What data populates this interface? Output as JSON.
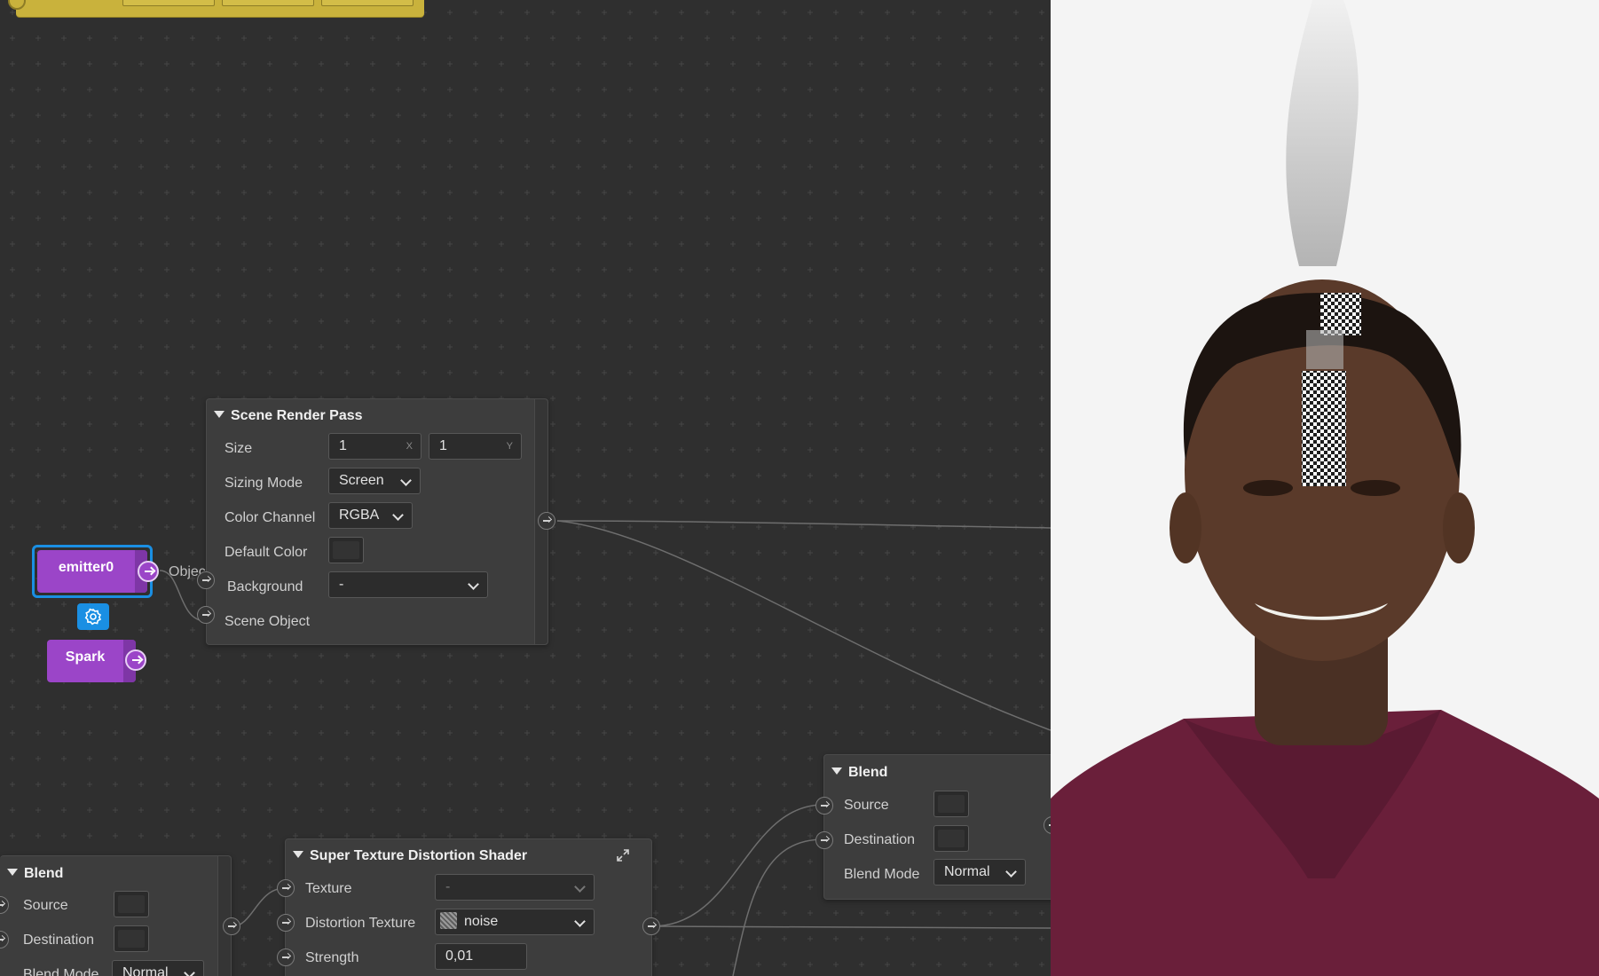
{
  "emitter": {
    "name": "emitter0",
    "out_label": "Object"
  },
  "spark": {
    "name": "Spark"
  },
  "scene_render_pass": {
    "title": "Scene Render Pass",
    "size_label": "Size",
    "size_x": "1",
    "size_x_suffix": "X",
    "size_y": "1",
    "size_y_suffix": "Y",
    "sizing_mode_label": "Sizing Mode",
    "sizing_mode": "Screen",
    "color_channel_label": "Color Channel",
    "color_channel": "RGBA",
    "default_color_label": "Default Color",
    "background_label": "Background",
    "background": "-",
    "scene_object_label": "Scene Object"
  },
  "blend_right": {
    "title": "Blend",
    "source_label": "Source",
    "destination_label": "Destination",
    "blend_mode_label": "Blend Mode",
    "blend_mode": "Normal"
  },
  "blend_left": {
    "title": "Blend",
    "source_label": "Source",
    "destination_label": "Destination",
    "blend_mode_label": "Blend Mode",
    "blend_mode": "Normal"
  },
  "distortion_shader": {
    "title": "Super Texture Distortion Shader",
    "texture_label": "Texture",
    "texture": "-",
    "distortion_texture_label": "Distortion Texture",
    "distortion_texture": "noise",
    "strength_label": "Strength",
    "strength": "0,01"
  },
  "icons": [
    "gear-icon",
    "expand-icon",
    "arrow-right-icon",
    "chevron-down-icon",
    "triangle-down-icon"
  ],
  "colors": {
    "canvas": "#2f2f2f",
    "node": "#3d3d3d",
    "purple": "#9b45c8",
    "selection": "#1a8fe3",
    "yellow": "#c9b23c"
  }
}
